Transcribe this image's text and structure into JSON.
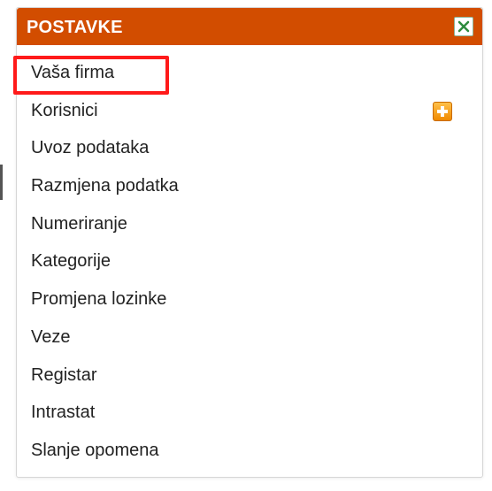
{
  "panel": {
    "title": "POSTAVKE",
    "header_color": "#d24d00",
    "close_icon": "close-icon",
    "highlight_color": "#ff1a1a"
  },
  "menu": {
    "items": [
      {
        "label": "Vaša firma",
        "highlighted": true
      },
      {
        "label": "Korisnici",
        "icon": "add-icon"
      },
      {
        "label": "Uvoz podataka"
      },
      {
        "label": "Razmjena podatka"
      },
      {
        "label": "Numeriranje"
      },
      {
        "label": "Kategorije"
      },
      {
        "label": "Promjena lozinke"
      },
      {
        "label": "Veze"
      },
      {
        "label": "Registar"
      },
      {
        "label": "Intrastat"
      },
      {
        "label": "Slanje opomena"
      }
    ]
  }
}
